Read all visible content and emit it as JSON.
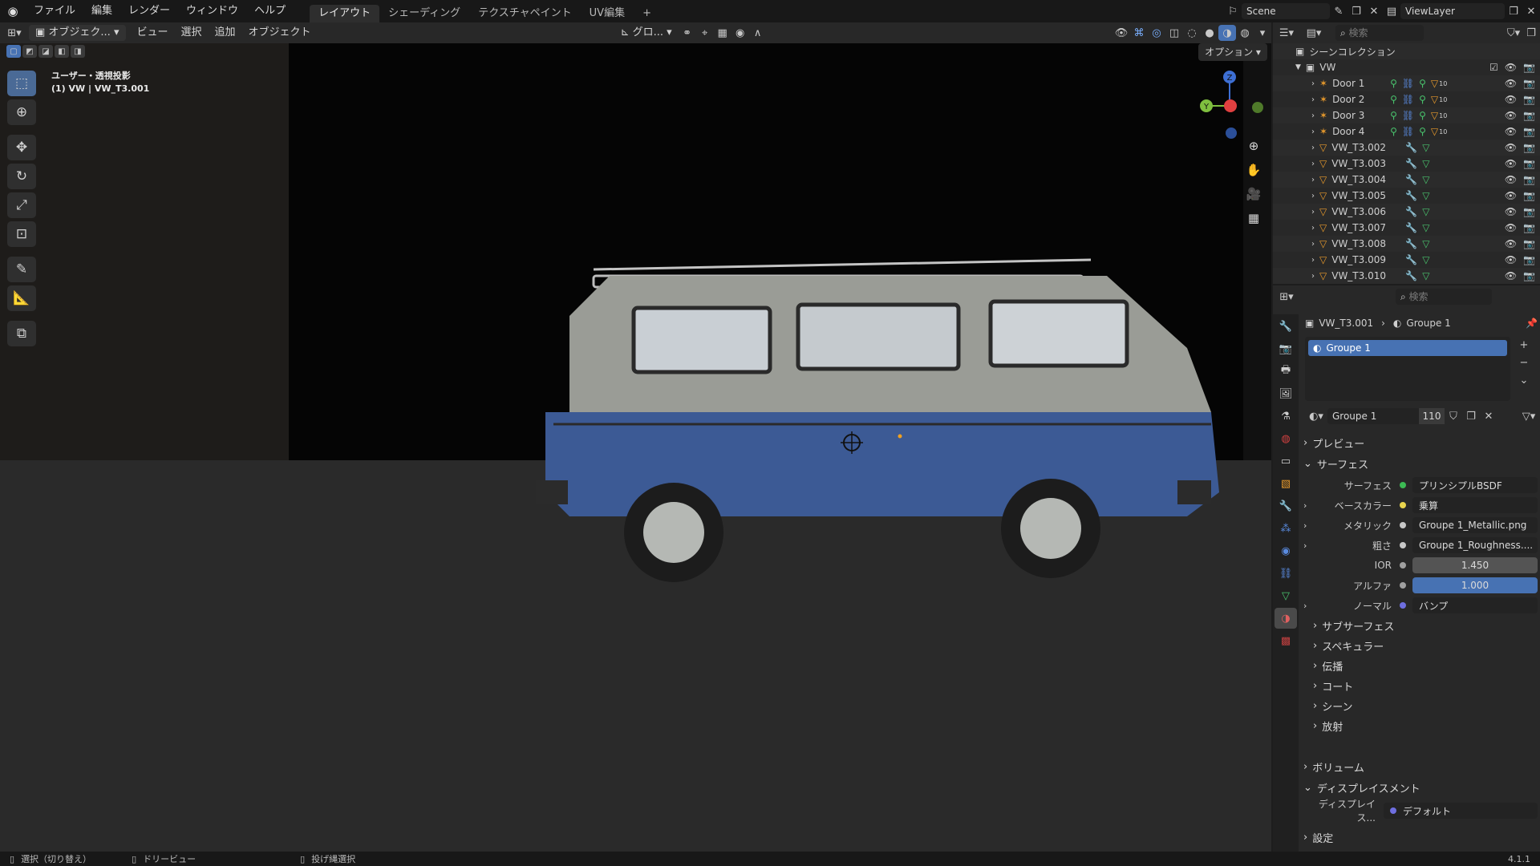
{
  "topbar": {
    "menus": [
      "ファイル",
      "編集",
      "レンダー",
      "ウィンドウ",
      "ヘルプ"
    ],
    "tabs": [
      "レイアウト",
      "シェーディング",
      "テクスチャペイント",
      "UV編集"
    ],
    "add_tab": "+",
    "scene": "Scene",
    "view_layer": "ViewLayer"
  },
  "viewport_header": {
    "mode": "オブジェク...",
    "menus": [
      "ビュー",
      "選択",
      "追加",
      "オブジェクト"
    ],
    "transform_orientation": "グロ...",
    "options": "オプション"
  },
  "viewport": {
    "view_name": "ユーザー・透視投影",
    "active_object": "(1) VW | VW_T3.001",
    "gizmo": {
      "z": "Z",
      "y": "Y"
    }
  },
  "outliner": {
    "search_placeholder": "検索",
    "collection": "シーンコレクション",
    "root": "VW",
    "items": [
      {
        "name": "Door 1",
        "type": "armature",
        "badge": "10"
      },
      {
        "name": "Door 2",
        "type": "armature",
        "badge": "10"
      },
      {
        "name": "Door 3",
        "type": "armature",
        "badge": "10"
      },
      {
        "name": "Door 4",
        "type": "armature",
        "badge": "10"
      },
      {
        "name": "VW_T3.002",
        "type": "mesh"
      },
      {
        "name": "VW_T3.003",
        "type": "mesh"
      },
      {
        "name": "VW_T3.004",
        "type": "mesh"
      },
      {
        "name": "VW_T3.005",
        "type": "mesh"
      },
      {
        "name": "VW_T3.006",
        "type": "mesh"
      },
      {
        "name": "VW_T3.007",
        "type": "mesh"
      },
      {
        "name": "VW_T3.008",
        "type": "mesh"
      },
      {
        "name": "VW_T3.009",
        "type": "mesh"
      },
      {
        "name": "VW_T3.010",
        "type": "mesh"
      }
    ]
  },
  "properties": {
    "search_placeholder": "検索",
    "breadcrumb_object": "VW_T3.001",
    "breadcrumb_material": "Groupe 1",
    "slot": "Groupe 1",
    "material_name": "Groupe 1",
    "user_count": "110",
    "sections": {
      "preview": "プレビュー",
      "surface": "サーフェス",
      "volume": "ボリューム",
      "displacement": "ディスプレイスメント",
      "settings": "設定"
    },
    "surface_rows": [
      {
        "label": "サーフェス",
        "value": "プリンシプルBSDF",
        "dot": "#3cba54"
      },
      {
        "label": "ベースカラー",
        "value": "乗算",
        "dot": "#e8d44d",
        "expand": true
      },
      {
        "label": "メタリック",
        "value": "Groupe 1_Metallic.png",
        "dot": "#c8c8c8",
        "expand": true
      },
      {
        "label": "粗さ",
        "value": "Groupe 1_Roughness....",
        "dot": "#c8c8c8",
        "expand": true
      },
      {
        "label": "IOR",
        "value": "1.450",
        "dot": "#a0a0a0",
        "style": "num"
      },
      {
        "label": "アルファ",
        "value": "1.000",
        "dot": "#a0a0a0",
        "style": "blue"
      },
      {
        "label": "ノーマル",
        "value": "バンプ",
        "dot": "#6f6fe0",
        "expand": true
      }
    ],
    "subsections": [
      "サブサーフェス",
      "スペキュラー",
      "伝播",
      "コート",
      "シーン",
      "放射"
    ],
    "displacement_row": {
      "label": "ディスプレイス...",
      "value": "デフォルト"
    }
  },
  "statusbar": {
    "select": "選択（切り替え）",
    "dolly": "ドリービュー",
    "lasso": "投げ縄選択",
    "version": "4.1.1"
  }
}
